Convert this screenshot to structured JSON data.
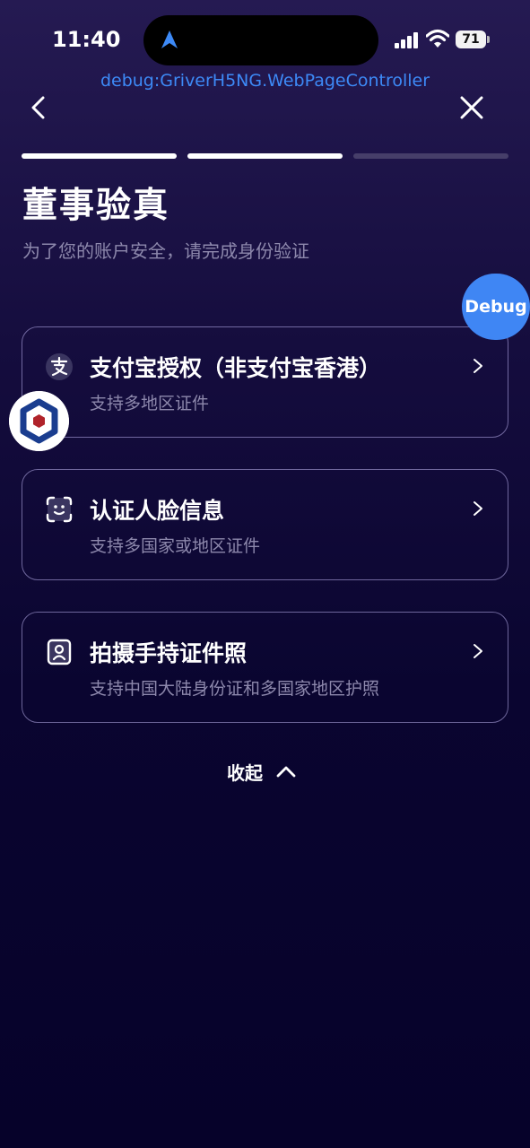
{
  "status_bar": {
    "time": "11:40",
    "battery": "71",
    "icons": [
      "location-arrow-icon",
      "signal-icon",
      "wifi-icon",
      "battery-icon"
    ]
  },
  "debug_label": "debug:GriverH5NG.WebPageController",
  "nav": {
    "back_icon": "chevron-left-icon",
    "close_icon": "close-icon"
  },
  "progress": {
    "steps_total": 3,
    "steps_done": 2
  },
  "header": {
    "title": "董事验真",
    "subtitle": "为了您的账户安全，请完成身份验证"
  },
  "debug_button": "Debug",
  "options": [
    {
      "icon": "alipay-icon",
      "title": "支付宝授权（非支付宝香港）",
      "description": "支持多地区证件"
    },
    {
      "icon": "face-scan-icon",
      "title": "认证人脸信息",
      "description": "支持多国家或地区证件"
    },
    {
      "icon": "id-card-icon",
      "title": "拍摄手持证件照",
      "description": "支持中国大陆身份证和多国家地区护照"
    }
  ],
  "collapse": {
    "label": "收起",
    "icon": "chevron-up-icon"
  },
  "colors": {
    "accent_blue": "#3f86f4",
    "debug_text": "#3d8af7",
    "background_top": "#251a52",
    "background_bottom": "#06022a",
    "secondary_text": "#8d88ac"
  }
}
